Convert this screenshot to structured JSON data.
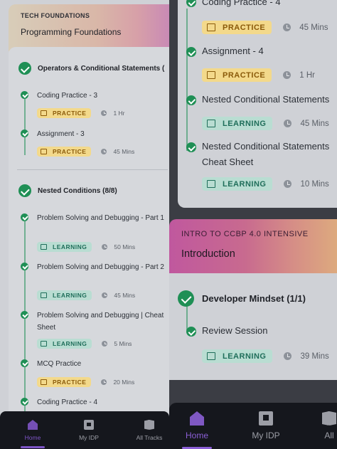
{
  "colors": {
    "accent": "#7e55c7",
    "success": "#1f8f55",
    "practice_bg": "#f3d98b",
    "learning_bg": "#b9ddd2"
  },
  "left": {
    "header": {
      "overline": "TECH FOUNDATIONS",
      "title": "Programming Foundations"
    },
    "sections": [
      {
        "title": "Operators & Conditional Statements (",
        "items": [
          {
            "title": "Coding Practice - 3",
            "tag": "PRACTICE",
            "duration": "1 Hr"
          },
          {
            "title": "Assignment - 3",
            "tag": "PRACTICE",
            "duration": "45 Mins"
          }
        ]
      },
      {
        "title": "Nested Conditions (8/8)",
        "items": [
          {
            "title": "Problem Solving and Debugging - Part 1",
            "tag": "LEARNING",
            "duration": "50 Mins"
          },
          {
            "title": "Problem Solving and Debugging - Part 2",
            "tag": "LEARNING",
            "duration": "45 Mins"
          },
          {
            "title": "Problem Solving and Debugging | Cheat Sheet",
            "tag": "LEARNING",
            "duration": "5 Mins"
          },
          {
            "title": "MCQ Practice",
            "tag": "PRACTICE",
            "duration": "20 Mins"
          },
          {
            "title": "Coding Practice - 4"
          }
        ]
      }
    ],
    "nav": {
      "home": "Home",
      "idp": "My IDP",
      "tracks": "All Tracks"
    }
  },
  "right": {
    "items": [
      {
        "title": "Coding Practice - 4",
        "tag": "PRACTICE",
        "duration": "45 Mins"
      },
      {
        "title": "Assignment - 4",
        "tag": "PRACTICE",
        "duration": "1 Hr"
      },
      {
        "title": "Nested Conditional Statements",
        "tag": "LEARNING",
        "duration": "45 Mins"
      },
      {
        "title": "Nested Conditional Statements Cheat Sheet",
        "title_line1": "Nested Conditional Statements",
        "title_line2": "Cheat Sheet",
        "tag": "LEARNING",
        "duration": "10 Mins"
      }
    ],
    "header": {
      "overline": "INTRO TO CCBP 4.0 INTENSIVE",
      "title": "Introduction"
    },
    "section": {
      "title": "Developer Mindset (1/1)",
      "items": [
        {
          "title": "Review Session",
          "tag": "LEARNING",
          "duration": "39 Mins"
        }
      ]
    },
    "nav": {
      "home": "Home",
      "idp": "My IDP",
      "tracks_partial": "All"
    }
  }
}
